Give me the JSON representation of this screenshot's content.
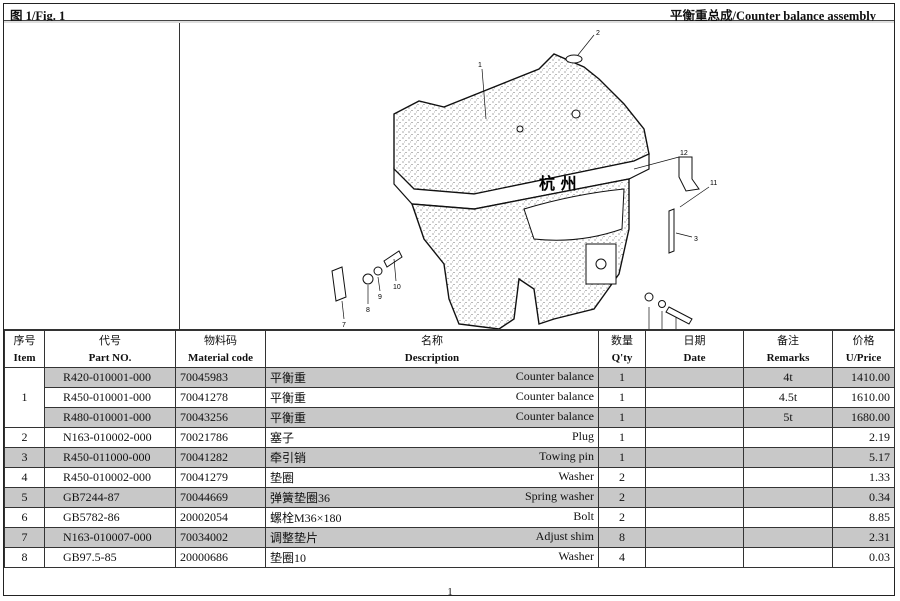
{
  "header": {
    "fig_label": "图 1/Fig. 1",
    "assembly_title": "平衡重总成/Counter balance assembly"
  },
  "figure": {
    "emblem": "杭 州",
    "callouts": [
      "1",
      "2",
      "3",
      "4",
      "5",
      "6",
      "7",
      "8",
      "9",
      "10",
      "11",
      "12"
    ]
  },
  "table": {
    "headers_cn": [
      "序号",
      "代号",
      "物料码",
      "名称",
      "数量",
      "日期",
      "备注",
      "价格"
    ],
    "headers_en": [
      "Item",
      "Part NO.",
      "Material code",
      "Description",
      "Q'ty",
      "Date",
      "Remarks",
      "U/Price"
    ],
    "rows": [
      {
        "item": "1",
        "part": "R420-010001-000",
        "code": "70045983",
        "cn": "平衡重",
        "en": "Counter balance",
        "qty": "1",
        "date": "",
        "remarks": "4t",
        "price": "1410.00",
        "shaded": true
      },
      {
        "item": "",
        "part": "R450-010001-000",
        "code": "70041278",
        "cn": "平衡重",
        "en": "Counter balance",
        "qty": "1",
        "date": "",
        "remarks": "4.5t",
        "price": "1610.00",
        "shaded": false
      },
      {
        "item": "",
        "part": "R480-010001-000",
        "code": "70043256",
        "cn": "平衡重",
        "en": "Counter balance",
        "qty": "1",
        "date": "",
        "remarks": "5t",
        "price": "1680.00",
        "shaded": true
      },
      {
        "item": "2",
        "part": "N163-010002-000",
        "code": "70021786",
        "cn": "塞子",
        "en": "Plug",
        "qty": "1",
        "date": "",
        "remarks": "",
        "price": "2.19",
        "shaded": false
      },
      {
        "item": "3",
        "part": "R450-011000-000",
        "code": "70041282",
        "cn": "牵引销",
        "en": "Towing pin",
        "qty": "1",
        "date": "",
        "remarks": "",
        "price": "5.17",
        "shaded": true
      },
      {
        "item": "4",
        "part": "R450-010002-000",
        "code": "70041279",
        "cn": "垫圈",
        "en": "Washer",
        "qty": "2",
        "date": "",
        "remarks": "",
        "price": "1.33",
        "shaded": false
      },
      {
        "item": "5",
        "part": "GB7244-87",
        "code": "70044669",
        "cn": "弹簧垫圈36",
        "en": "Spring washer",
        "qty": "2",
        "date": "",
        "remarks": "",
        "price": "0.34",
        "shaded": true
      },
      {
        "item": "6",
        "part": "GB5782-86",
        "code": "20002054",
        "cn": "螺栓M36×180",
        "en": "Bolt",
        "qty": "2",
        "date": "",
        "remarks": "",
        "price": "8.85",
        "shaded": false
      },
      {
        "item": "7",
        "part": "N163-010007-000",
        "code": "70034002",
        "cn": "调整垫片",
        "en": "Adjust shim",
        "qty": "8",
        "date": "",
        "remarks": "",
        "price": "2.31",
        "shaded": true
      },
      {
        "item": "8",
        "part": "GB97.5-85",
        "code": "20000686",
        "cn": "垫圈10",
        "en": "Washer",
        "qty": "4",
        "date": "",
        "remarks": "",
        "price": "0.03",
        "shaded": false
      }
    ]
  },
  "footer": {
    "page_number": "1"
  }
}
